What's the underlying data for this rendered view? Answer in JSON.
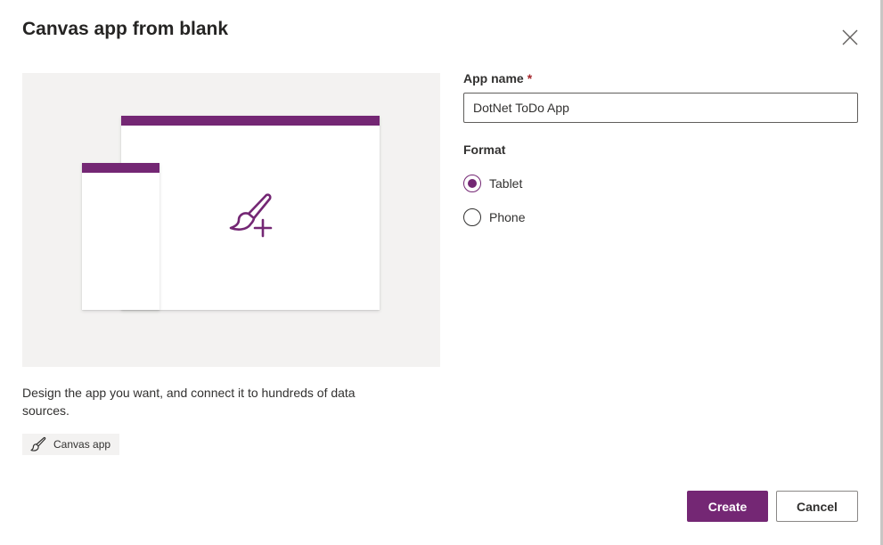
{
  "dialog": {
    "title": "Canvas app from blank",
    "close_icon": "close-icon"
  },
  "preview": {
    "description": "Design the app you want, and connect it to hundreds of data sources.",
    "tag_label": "Canvas app",
    "tag_icon": "brush-icon",
    "illustration_icon": "brush-plus-icon"
  },
  "form": {
    "app_name_label": "App name",
    "required_marker": "*",
    "app_name_value": "DotNet ToDo App",
    "format_label": "Format",
    "format_options": [
      {
        "label": "Tablet",
        "checked": true
      },
      {
        "label": "Phone",
        "checked": false
      }
    ]
  },
  "actions": {
    "create_label": "Create",
    "cancel_label": "Cancel"
  },
  "colors": {
    "accent": "#742774",
    "preview_bg": "#f3f2f1",
    "required": "#a4262c"
  }
}
